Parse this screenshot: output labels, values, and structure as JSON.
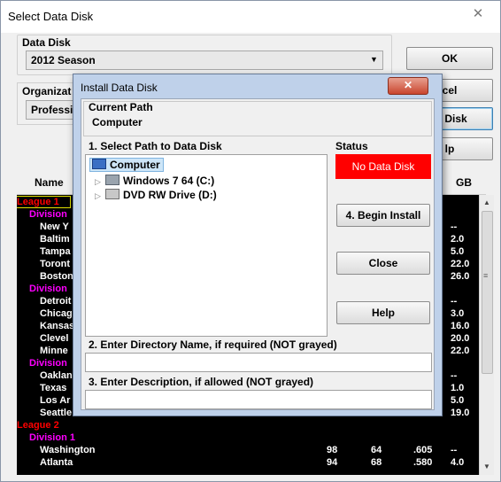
{
  "outer": {
    "title": "Select Data Disk",
    "close_glyph": "✕",
    "data_disk_label": "Data Disk",
    "data_disk_value": "2012  Season",
    "organization_label": "Organizat",
    "organization_value": "Professi",
    "ok_label": "OK",
    "cancel_label": "cel",
    "install_label": "ta Disk",
    "help_label": "lp"
  },
  "table": {
    "col_name": "Name",
    "col_gb": "GB",
    "rows": [
      {
        "kind": "league",
        "name": "League 1"
      },
      {
        "kind": "division",
        "name": "Division"
      },
      {
        "kind": "team",
        "name": "New Y",
        "gb": "--"
      },
      {
        "kind": "team",
        "name": "Baltim",
        "gb": "2.0"
      },
      {
        "kind": "team",
        "name": "Tampa",
        "gb": "5.0"
      },
      {
        "kind": "team",
        "name": "Toront",
        "gb": "22.0"
      },
      {
        "kind": "team",
        "name": "Boston",
        "gb": "26.0"
      },
      {
        "kind": "division",
        "name": "Division"
      },
      {
        "kind": "team",
        "name": "Detroit",
        "gb": "--"
      },
      {
        "kind": "team",
        "name": "Chicag",
        "gb": "3.0"
      },
      {
        "kind": "team",
        "name": "Kansas",
        "gb": "16.0"
      },
      {
        "kind": "team",
        "name": "Clevel",
        "gb": "20.0"
      },
      {
        "kind": "team",
        "name": "Minne",
        "gb": "22.0"
      },
      {
        "kind": "division",
        "name": "Division"
      },
      {
        "kind": "team",
        "name": "Oaklan",
        "gb": "--"
      },
      {
        "kind": "team",
        "name": "Texas",
        "gb": "1.0"
      },
      {
        "kind": "team",
        "name": "Los Ar",
        "gb": "5.0"
      },
      {
        "kind": "team",
        "name": "Seattle",
        "gb": "19.0"
      },
      {
        "kind": "league",
        "name": "League 2"
      },
      {
        "kind": "division",
        "name": "Division 1"
      },
      {
        "kind": "team",
        "name": "Washington",
        "w": "98",
        "l": "64",
        "pct": ".605",
        "gb": "--"
      },
      {
        "kind": "team",
        "name": "Atlanta",
        "w": "94",
        "l": "68",
        "pct": ".580",
        "gb": "4.0"
      }
    ]
  },
  "inner": {
    "title": "Install Data Disk",
    "close_glyph": "✕",
    "current_path_label": "Current Path",
    "current_path_value": "Computer",
    "select_path_label": "1. Select Path to Data Disk",
    "tree": {
      "root": "Computer",
      "drive_c": "Windows 7 64 (C:)",
      "drive_d": "DVD RW Drive (D:)"
    },
    "status_label": "Status",
    "status_value": "No Data Disk",
    "begin_install_label": "4. Begin Install",
    "close_label": "Close",
    "help_label": "Help",
    "dir_name_label": "2. Enter Directory Name, if required (NOT grayed)",
    "description_label": "3. Enter Description, if allowed (NOT grayed)",
    "dir_name_value": "",
    "description_value": ""
  },
  "colors": {
    "league": "#ff0000",
    "division": "#ff00ff",
    "status_bg": "#ff0000",
    "status_text": "#ffffff"
  }
}
